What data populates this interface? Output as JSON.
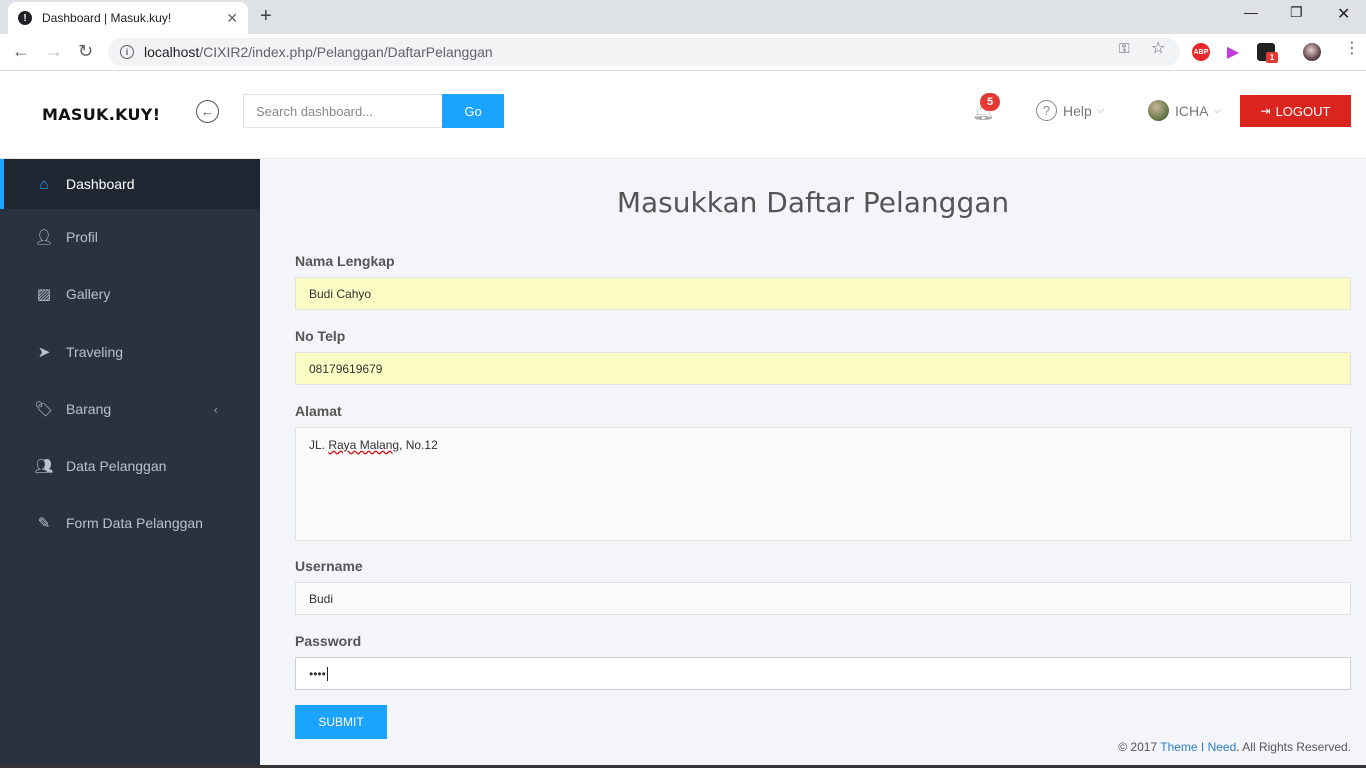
{
  "browser": {
    "tab_title": "Dashboard | Masuk.kuy!",
    "url_host": "localhost",
    "url_path": "/CIXIR2/index.php/Pelanggan/DaftarPelanggan",
    "ext_abp": "ABP",
    "ext_badge": "1"
  },
  "header": {
    "logo": "MASUK.KUY!",
    "search_placeholder": "Search dashboard...",
    "go_label": "Go",
    "notification_count": "5",
    "help_label": "Help",
    "user_name": "ICHA",
    "logout_label": "LOGOUT"
  },
  "sidebar": {
    "items": [
      {
        "label": "Dashboard",
        "icon": "home-icon"
      },
      {
        "label": "Profil",
        "icon": "user-icon"
      },
      {
        "label": "Gallery",
        "icon": "image-icon"
      },
      {
        "label": "Traveling",
        "icon": "send-icon"
      },
      {
        "label": "Barang",
        "icon": "tags-icon"
      },
      {
        "label": "Data Pelanggan",
        "icon": "users-icon"
      },
      {
        "label": "Form Data Pelanggan",
        "icon": "edit-icon"
      }
    ]
  },
  "form": {
    "title": "Masukkan Daftar Pelanggan",
    "nama_label": "Nama Lengkap",
    "nama_value": "Budi Cahyo",
    "telp_label": "No Telp",
    "telp_value": "08179619679",
    "alamat_label": "Alamat",
    "alamat_value_a": "JL. ",
    "alamat_value_b": "Raya Malang",
    "alamat_value_c": ", No.12",
    "username_label": "Username",
    "username_value": "Budi",
    "password_label": "Password",
    "password_value": "••••",
    "submit_label": "SUBMIT"
  },
  "footer": {
    "prefix": "© 2017 ",
    "link": "Theme I Need",
    "suffix": ". All Rights Reserved."
  },
  "colors": {
    "accent": "#1aa3ff",
    "logout": "#d9251d",
    "sidebar_bg": "#283241",
    "autofill": "#fbfdc5"
  }
}
